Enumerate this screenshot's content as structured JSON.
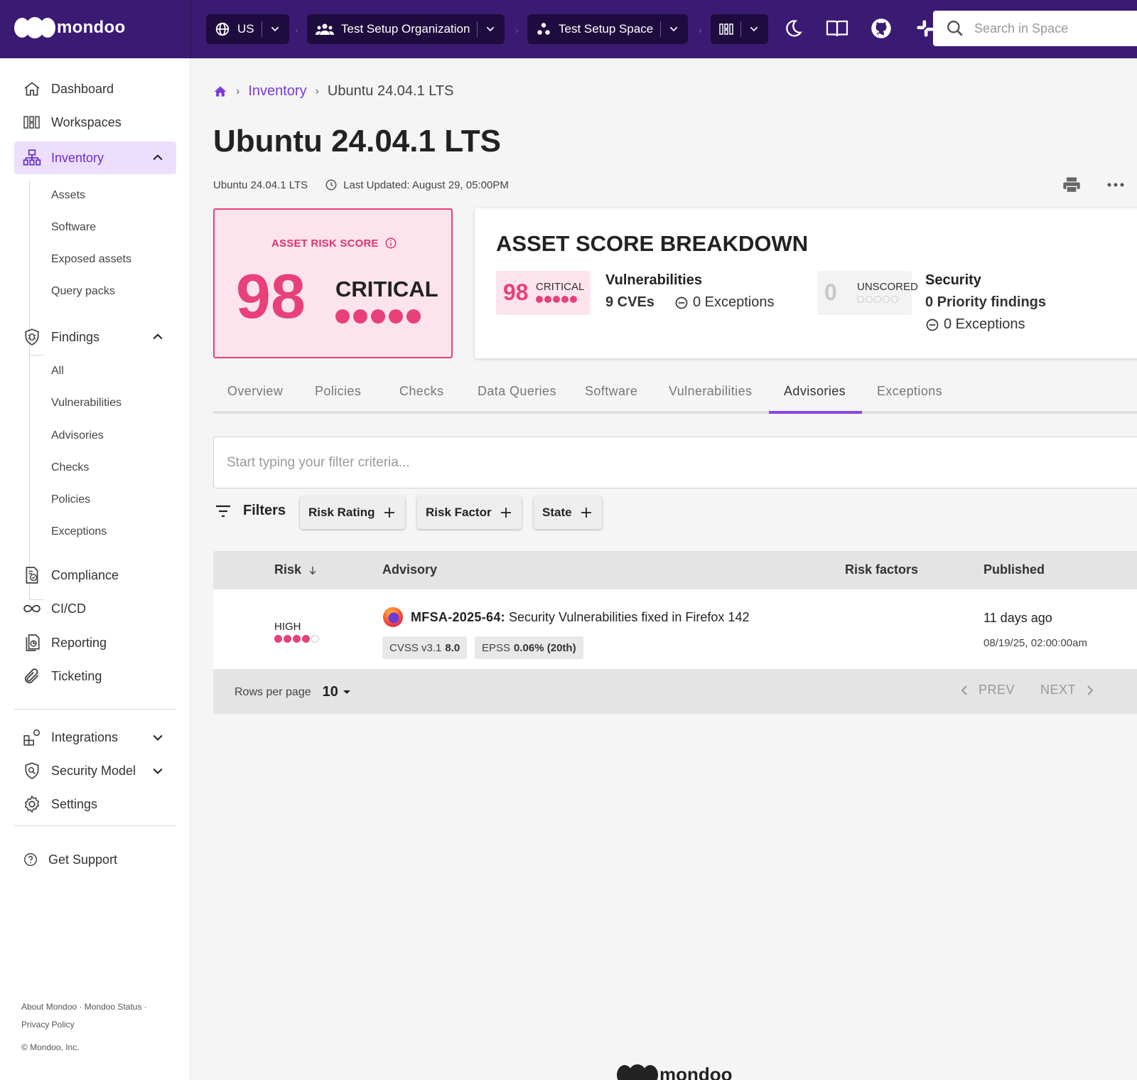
{
  "topbar": {
    "brand": "mondoo",
    "region": "US",
    "organization": "Test Setup Organization",
    "space": "Test Setup Space",
    "search_placeholder": "Search in Space"
  },
  "sidebar": {
    "items": [
      {
        "label": "Dashboard"
      },
      {
        "label": "Workspaces"
      },
      {
        "label": "Inventory"
      }
    ],
    "inventory_sub": [
      "Assets",
      "Software",
      "Exposed assets",
      "Query packs"
    ],
    "findings_label": "Findings",
    "findings_sub": [
      "All",
      "Vulnerabilities",
      "Advisories",
      "Checks",
      "Policies",
      "Exceptions"
    ],
    "more_items": [
      "Compliance",
      "CI/CD",
      "Reporting",
      "Ticketing"
    ],
    "admin_items": [
      "Integrations",
      "Security Model",
      "Settings"
    ],
    "support": "Get Support",
    "footer": {
      "about": "About Mondoo",
      "status": "Mondoo Status",
      "privacy": "Privacy Policy",
      "copyright": "© Mondoo, Inc."
    }
  },
  "breadcrumb": {
    "parent": "Inventory",
    "current": "Ubuntu 24.04.1 LTS"
  },
  "page": {
    "title": "Ubuntu 24.04.1 LTS",
    "subtitle": "Ubuntu 24.04.1 LTS",
    "last_updated": "Last Updated: August 29, 05:00PM"
  },
  "risk_card": {
    "label": "ASSET RISK SCORE",
    "score": "98",
    "rating": "CRITICAL",
    "level_dots": 5,
    "color": "#e8407a"
  },
  "breakdown": {
    "title": "ASSET SCORE BREAKDOWN",
    "vulnerabilities": {
      "score": "98",
      "rating": "CRITICAL",
      "heading": "Vulnerabilities",
      "cves": "9 CVEs",
      "exceptions": "0 Exceptions"
    },
    "security": {
      "score": "0",
      "rating": "UNSCORED",
      "heading": "Security",
      "priority": "0 Priority findings",
      "exceptions": "0 Exceptions"
    }
  },
  "tabs": [
    "Overview",
    "Policies",
    "Checks",
    "Data Queries",
    "Software",
    "Vulnerabilities",
    "Advisories",
    "Exceptions"
  ],
  "active_tab": "Advisories",
  "filter": {
    "placeholder": "Start typing your filter criteria...",
    "label": "Filters",
    "chips": [
      "Risk Rating",
      "Risk Factor",
      "State"
    ]
  },
  "table": {
    "columns": [
      "Risk",
      "Advisory",
      "Risk factors",
      "Published"
    ],
    "rows": [
      {
        "risk": "HIGH",
        "risk_level": 4,
        "advisory_id": "MFSA-2025-64:",
        "advisory_title": "Security Vulnerabilities fixed in Firefox 142",
        "cvss_label": "CVSS v3.1",
        "cvss_value": "8.0",
        "epss_label": "EPSS",
        "epss_value": "0.06% (20th)",
        "published_relative": "11 days ago",
        "published_date": "08/19/25, 02:00:00am"
      }
    ],
    "rows_per_page_label": "Rows per page",
    "rows_per_page": "10",
    "prev": "PREV",
    "next": "NEXT"
  },
  "colors": {
    "topbar": "#3b1a73",
    "accent": "#7a3ad6",
    "critical": "#e8407a"
  }
}
